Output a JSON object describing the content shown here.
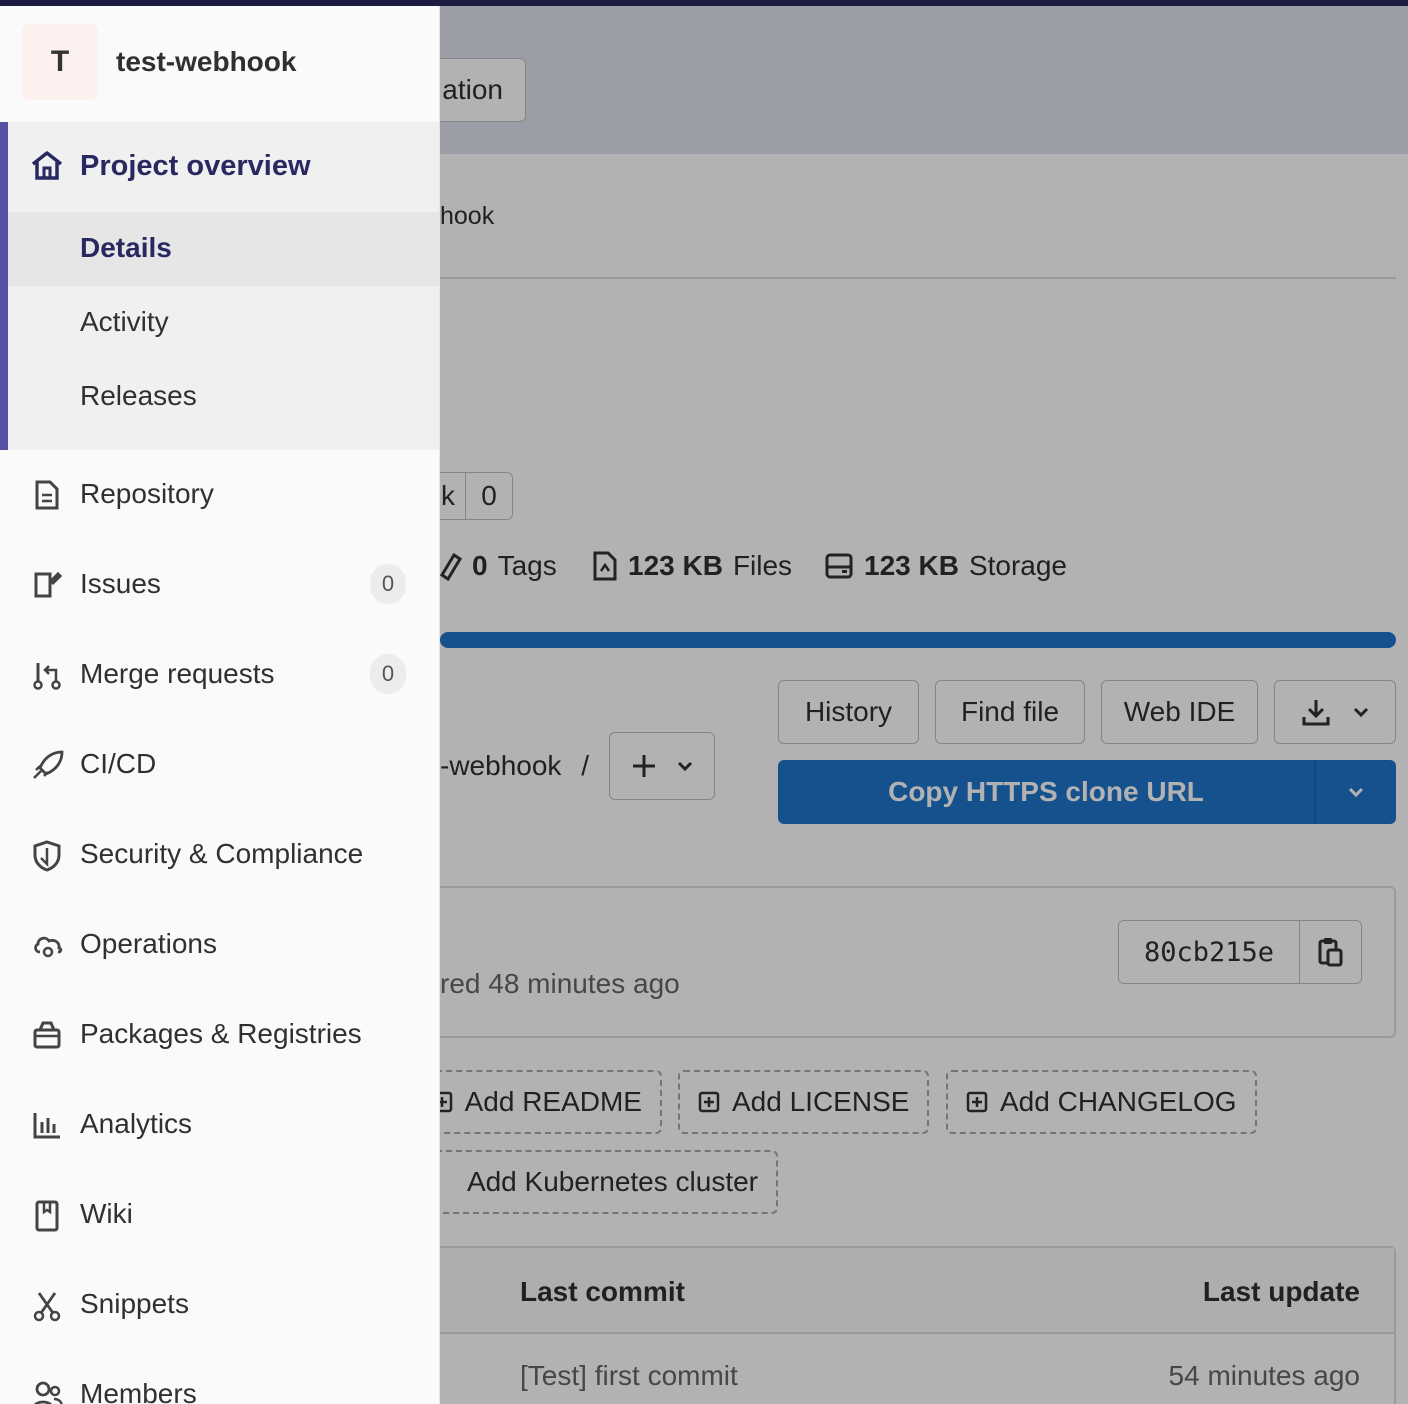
{
  "sidebar": {
    "avatar_letter": "T",
    "project_name": "test-webhook",
    "overview": {
      "label": "Project overview",
      "subitems": [
        {
          "label": "Details"
        },
        {
          "label": "Activity"
        },
        {
          "label": "Releases"
        }
      ]
    },
    "items": [
      {
        "label": "Repository",
        "icon": "document-icon"
      },
      {
        "label": "Issues",
        "icon": "issues-icon",
        "badge": "0"
      },
      {
        "label": "Merge requests",
        "icon": "merge-request-icon",
        "badge": "0"
      },
      {
        "label": "CI/CD",
        "icon": "rocket-icon"
      },
      {
        "label": "Security & Compliance",
        "icon": "shield-icon"
      },
      {
        "label": "Operations",
        "icon": "cloud-gear-icon"
      },
      {
        "label": "Packages & Registries",
        "icon": "package-icon"
      },
      {
        "label": "Analytics",
        "icon": "chart-icon"
      },
      {
        "label": "Wiki",
        "icon": "book-icon"
      },
      {
        "label": "Snippets",
        "icon": "scissors-icon"
      },
      {
        "label": "Members",
        "icon": "users-icon"
      }
    ]
  },
  "main": {
    "alert_button_partial": "ation",
    "breadcrumb_partial": "hook",
    "fork_partial": "k",
    "fork_count": "0",
    "stats": {
      "tags_count": "0",
      "tags_label": "Tags",
      "files_size": "123 KB",
      "files_label": "Files",
      "storage_size": "123 KB",
      "storage_label": "Storage"
    },
    "path_partial": "-webhook",
    "path_separator": "/",
    "buttons": {
      "history": "History",
      "find_file": "Find file",
      "web_ide": "Web IDE",
      "clone": "Copy HTTPS clone URL"
    },
    "commit": {
      "authored_partial": "red 48 minutes ago",
      "sha": "80cb215e"
    },
    "add_buttons": {
      "readme": "Add README",
      "license": "Add LICENSE",
      "changelog": "Add CHANGELOG",
      "kubernetes": "Add Kubernetes cluster"
    },
    "table": {
      "col_last_commit": "Last commit",
      "col_last_update": "Last update",
      "row_commit": "[Test] first commit",
      "row_update": "54 minutes ago"
    }
  },
  "colors": {
    "accent": "#292961",
    "active_border": "#5653a7",
    "primary_button": "#1f75cb"
  }
}
